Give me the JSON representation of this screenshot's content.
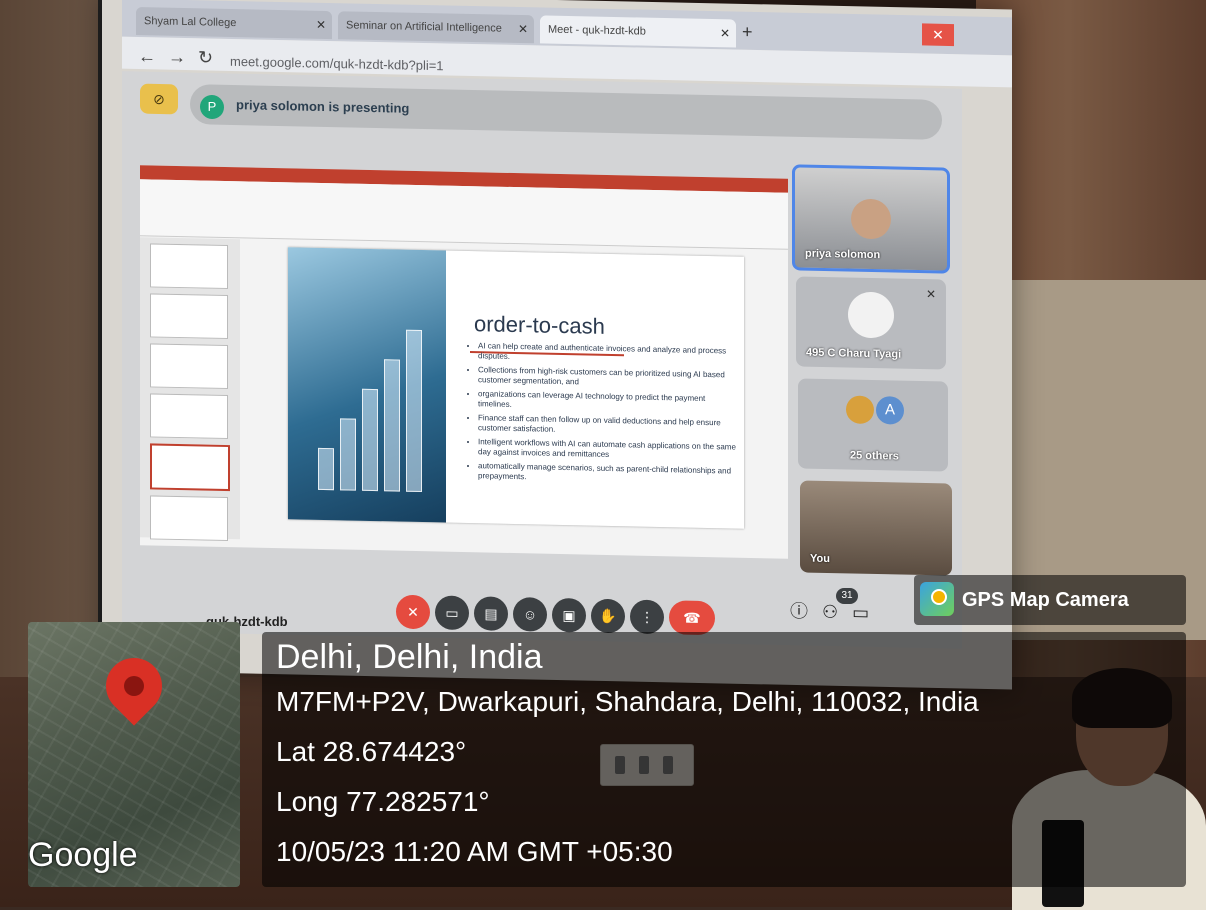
{
  "browser": {
    "tabs": [
      {
        "label": "Shyam Lal College"
      },
      {
        "label": "Seminar on Artificial Intelligence"
      },
      {
        "label": "Meet - quk-hzdt-kdb"
      }
    ],
    "url": "meet.google.com/quk-hzdt-kdb?pli=1"
  },
  "meet": {
    "presenter_initial": "P",
    "presenting_text": "priya solomon is presenting",
    "meeting_code": "quk-hzdt-kdb",
    "participants_count": "31",
    "tiles": [
      {
        "name": "priya solomon"
      },
      {
        "name": "495 C Charu Tyagi"
      },
      {
        "name": "25 others",
        "avatar_letter": "A"
      },
      {
        "name": "You"
      }
    ]
  },
  "slide": {
    "heading": "order-to-cash",
    "bullets": [
      "AI can help create and authenticate invoices   and analyze and process disputes.",
      "Collections from high-risk customers can be prioritized using AI based customer segmentation, and",
      "organizations can leverage AI technology to predict the payment timelines.",
      "Finance staff can then follow up on valid deductions and help ensure customer satisfaction.",
      "Intelligent workflows with AI can automate cash applications on the same day against invoices and remittances",
      "automatically manage scenarios, such as parent-child relationships and prepayments."
    ]
  },
  "gps": {
    "app_name": "GPS Map Camera",
    "map_brand": "Google",
    "place": "Delhi, Delhi, India",
    "address": "M7FM+P2V, Dwarkapuri, Shahdara, Delhi, 110032, India",
    "lat": "Lat 28.674423°",
    "long": "Long 77.282571°",
    "datetime": "10/05/23 11:20 AM GMT +05:30"
  },
  "colors": {
    "speaker_border": "#4f86e8",
    "end_call": "#e54b3f",
    "ppt_accent": "#c0402e",
    "pin": "#d93025"
  }
}
